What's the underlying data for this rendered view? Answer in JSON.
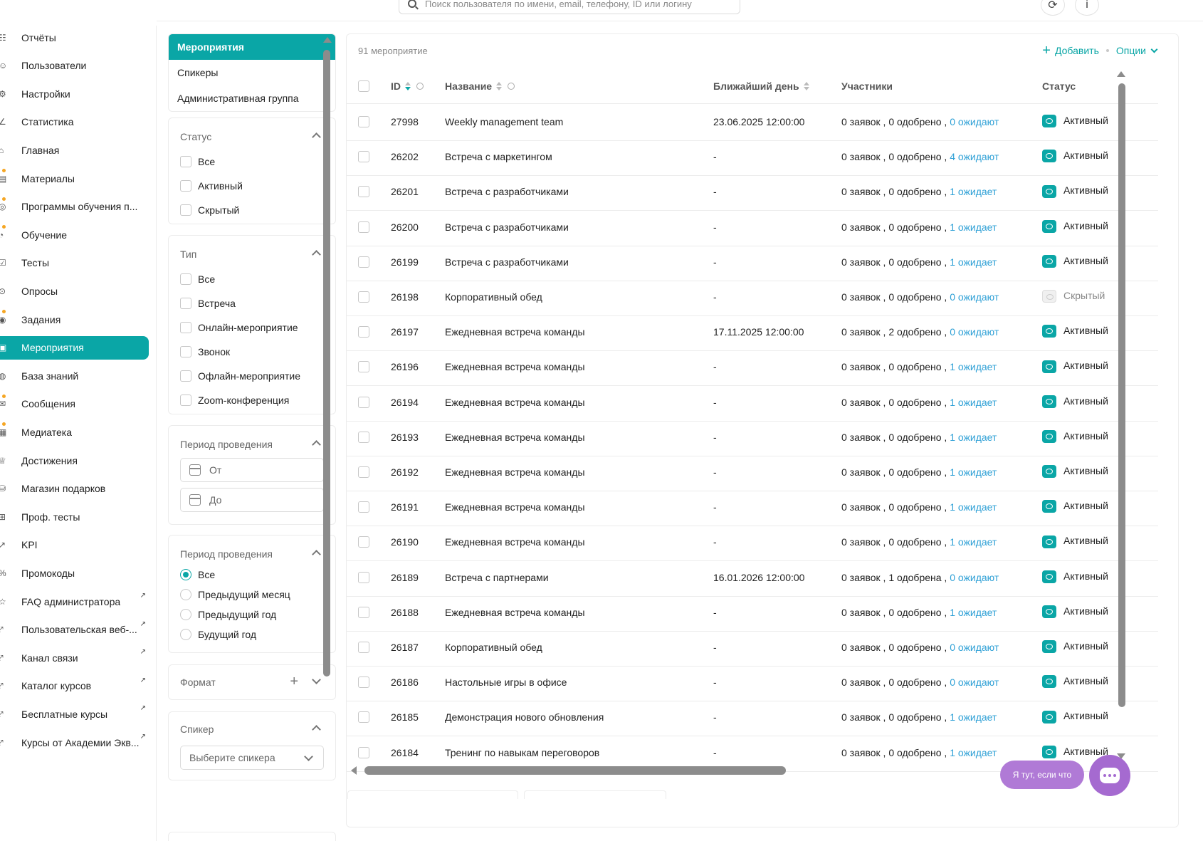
{
  "search": {
    "placeholder": "Поиск пользователя по имени, email, телефону, ID или логину"
  },
  "sidebar": {
    "items": [
      {
        "label": "Отчёты",
        "ext": false,
        "dot": false
      },
      {
        "label": "Пользователи",
        "ext": false,
        "dot": false
      },
      {
        "label": "Настройки",
        "ext": false,
        "dot": false
      },
      {
        "label": "Статистика",
        "ext": false,
        "dot": false
      },
      {
        "label": "Главная",
        "ext": false,
        "dot": false
      },
      {
        "label": "Материалы",
        "ext": false,
        "dot": true
      },
      {
        "label": "Программы обучения п...",
        "ext": false,
        "dot": true
      },
      {
        "label": "Обучение",
        "ext": false,
        "dot": true
      },
      {
        "label": "Тесты",
        "ext": false,
        "dot": false
      },
      {
        "label": "Опросы",
        "ext": false,
        "dot": false
      },
      {
        "label": "Задания",
        "ext": false,
        "dot": true
      },
      {
        "label": "Мероприятия",
        "ext": false,
        "dot": false,
        "active": true
      },
      {
        "label": "База знаний",
        "ext": false,
        "dot": false
      },
      {
        "label": "Сообщения",
        "ext": false,
        "dot": true
      },
      {
        "label": "Медиатека",
        "ext": false,
        "dot": true
      },
      {
        "label": "Достижения",
        "ext": false,
        "dot": false
      },
      {
        "label": "Магазин подарков",
        "ext": false,
        "dot": false
      },
      {
        "label": "Проф. тесты",
        "ext": false,
        "dot": false
      },
      {
        "label": "KPI",
        "ext": false,
        "dot": false
      },
      {
        "label": "Промокоды",
        "ext": false,
        "dot": false
      },
      {
        "label": "FAQ администратора",
        "ext": true,
        "dot": false
      },
      {
        "label": "Пользовательская веб-...",
        "ext": true,
        "dot": false
      },
      {
        "label": "Канал связи",
        "ext": true,
        "dot": false
      },
      {
        "label": "Каталог курсов",
        "ext": true,
        "dot": false
      },
      {
        "label": "Бесплатные курсы",
        "ext": true,
        "dot": false
      },
      {
        "label": "Курсы от Академии Экв...",
        "ext": true,
        "dot": false
      }
    ]
  },
  "tabs": [
    "Мероприятия",
    "Спикеры",
    "Административная группа"
  ],
  "filters": {
    "status": {
      "title": "Статус",
      "options": [
        "Все",
        "Активный",
        "Скрытый"
      ]
    },
    "type": {
      "title": "Тип",
      "options": [
        "Все",
        "Встреча",
        "Онлайн-мероприятие",
        "Звонок",
        "Офлайн-мероприятие",
        "Zoom-конференция"
      ]
    },
    "period_dates": {
      "title": "Период проведения",
      "from": "От",
      "to": "До"
    },
    "period_range": {
      "title": "Период проведения",
      "options": [
        "Все",
        "Предыдущий месяц",
        "Предыдущий год",
        "Будущий год"
      ],
      "selected": 0
    },
    "format": {
      "title": "Формат"
    },
    "speaker": {
      "title": "Спикер",
      "placeholder": "Выберите спикера"
    }
  },
  "table": {
    "count": "91 мероприятие",
    "add_label": "Добавить",
    "options_label": "Опции",
    "columns": {
      "id": "ID",
      "name": "Название",
      "day": "Ближайший день",
      "participants": "Участники",
      "status": "Статус"
    },
    "rows": [
      {
        "id": "27998",
        "name": "Weekly management team",
        "day": "23.06.2025 12:00:00",
        "part": "0 заявок , 0 одобрено , ",
        "wait": "0 ожидают",
        "status": "Активный",
        "hidden": false
      },
      {
        "id": "26202",
        "name": "Встреча с маркетингом",
        "day": "-",
        "part": "0 заявок , 0 одобрено , ",
        "wait": "4 ожидают",
        "status": "Активный",
        "hidden": false
      },
      {
        "id": "26201",
        "name": "Встреча с разработчиками",
        "day": "-",
        "part": "0 заявок , 0 одобрено , ",
        "wait": "1 ожидает",
        "status": "Активный",
        "hidden": false
      },
      {
        "id": "26200",
        "name": "Встреча с разработчиками",
        "day": "-",
        "part": "0 заявок , 0 одобрено , ",
        "wait": "1 ожидает",
        "status": "Активный",
        "hidden": false
      },
      {
        "id": "26199",
        "name": "Встреча с разработчиками",
        "day": "-",
        "part": "0 заявок , 0 одобрено , ",
        "wait": "1 ожидает",
        "status": "Активный",
        "hidden": false
      },
      {
        "id": "26198",
        "name": "Корпоративный обед",
        "day": "-",
        "part": "0 заявок , 0 одобрено , ",
        "wait": "0 ожидают",
        "status": "Скрытый",
        "hidden": true
      },
      {
        "id": "26197",
        "name": "Ежедневная встреча команды",
        "day": "17.11.2025 12:00:00",
        "part": "0 заявок , 2 одобрено , ",
        "wait": "0 ожидают",
        "status": "Активный",
        "hidden": false
      },
      {
        "id": "26196",
        "name": "Ежедневная встреча команды",
        "day": "-",
        "part": "0 заявок , 0 одобрено , ",
        "wait": "1 ожидает",
        "status": "Активный",
        "hidden": false
      },
      {
        "id": "26194",
        "name": "Ежедневная встреча команды",
        "day": "-",
        "part": "0 заявок , 0 одобрено , ",
        "wait": "1 ожидает",
        "status": "Активный",
        "hidden": false
      },
      {
        "id": "26193",
        "name": "Ежедневная встреча команды",
        "day": "-",
        "part": "0 заявок , 0 одобрено , ",
        "wait": "1 ожидает",
        "status": "Активный",
        "hidden": false
      },
      {
        "id": "26192",
        "name": "Ежедневная встреча команды",
        "day": "-",
        "part": "0 заявок , 0 одобрено , ",
        "wait": "1 ожидает",
        "status": "Активный",
        "hidden": false
      },
      {
        "id": "26191",
        "name": "Ежедневная встреча команды",
        "day": "-",
        "part": "0 заявок , 0 одобрено , ",
        "wait": "1 ожидает",
        "status": "Активный",
        "hidden": false
      },
      {
        "id": "26190",
        "name": "Ежедневная встреча команды",
        "day": "-",
        "part": "0 заявок , 0 одобрено , ",
        "wait": "1 ожидает",
        "status": "Активный",
        "hidden": false
      },
      {
        "id": "26189",
        "name": "Встреча с партнерами",
        "day": "16.01.2026 12:00:00",
        "part": "0 заявок , 1 одобрена , ",
        "wait": "0 ожидают",
        "status": "Активный",
        "hidden": false
      },
      {
        "id": "26188",
        "name": "Ежедневная встреча команды",
        "day": "-",
        "part": "0 заявок , 0 одобрено , ",
        "wait": "1 ожидает",
        "status": "Активный",
        "hidden": false
      },
      {
        "id": "26187",
        "name": "Корпоративный обед",
        "day": "-",
        "part": "0 заявок , 0 одобрено , ",
        "wait": "0 ожидают",
        "status": "Активный",
        "hidden": false
      },
      {
        "id": "26186",
        "name": "Настольные игры в офисе",
        "day": "-",
        "part": "0 заявок , 0 одобрено , ",
        "wait": "0 ожидают",
        "status": "Активный",
        "hidden": false
      },
      {
        "id": "26185",
        "name": "Демонстрация нового обновления",
        "day": "-",
        "part": "0 заявок , 0 одобрено , ",
        "wait": "1 ожидает",
        "status": "Активный",
        "hidden": false
      },
      {
        "id": "26184",
        "name": "Тренинг по навыкам переговоров",
        "day": "-",
        "part": "0 заявок , 0 одобрено , ",
        "wait": "1 ожидает",
        "status": "Активный",
        "hidden": false
      }
    ]
  },
  "chat": {
    "label": "Я тут, если что"
  },
  "colors": {
    "accent": "#0aa6a6",
    "link": "#2ea0d6",
    "chat": "#a56ad0"
  }
}
